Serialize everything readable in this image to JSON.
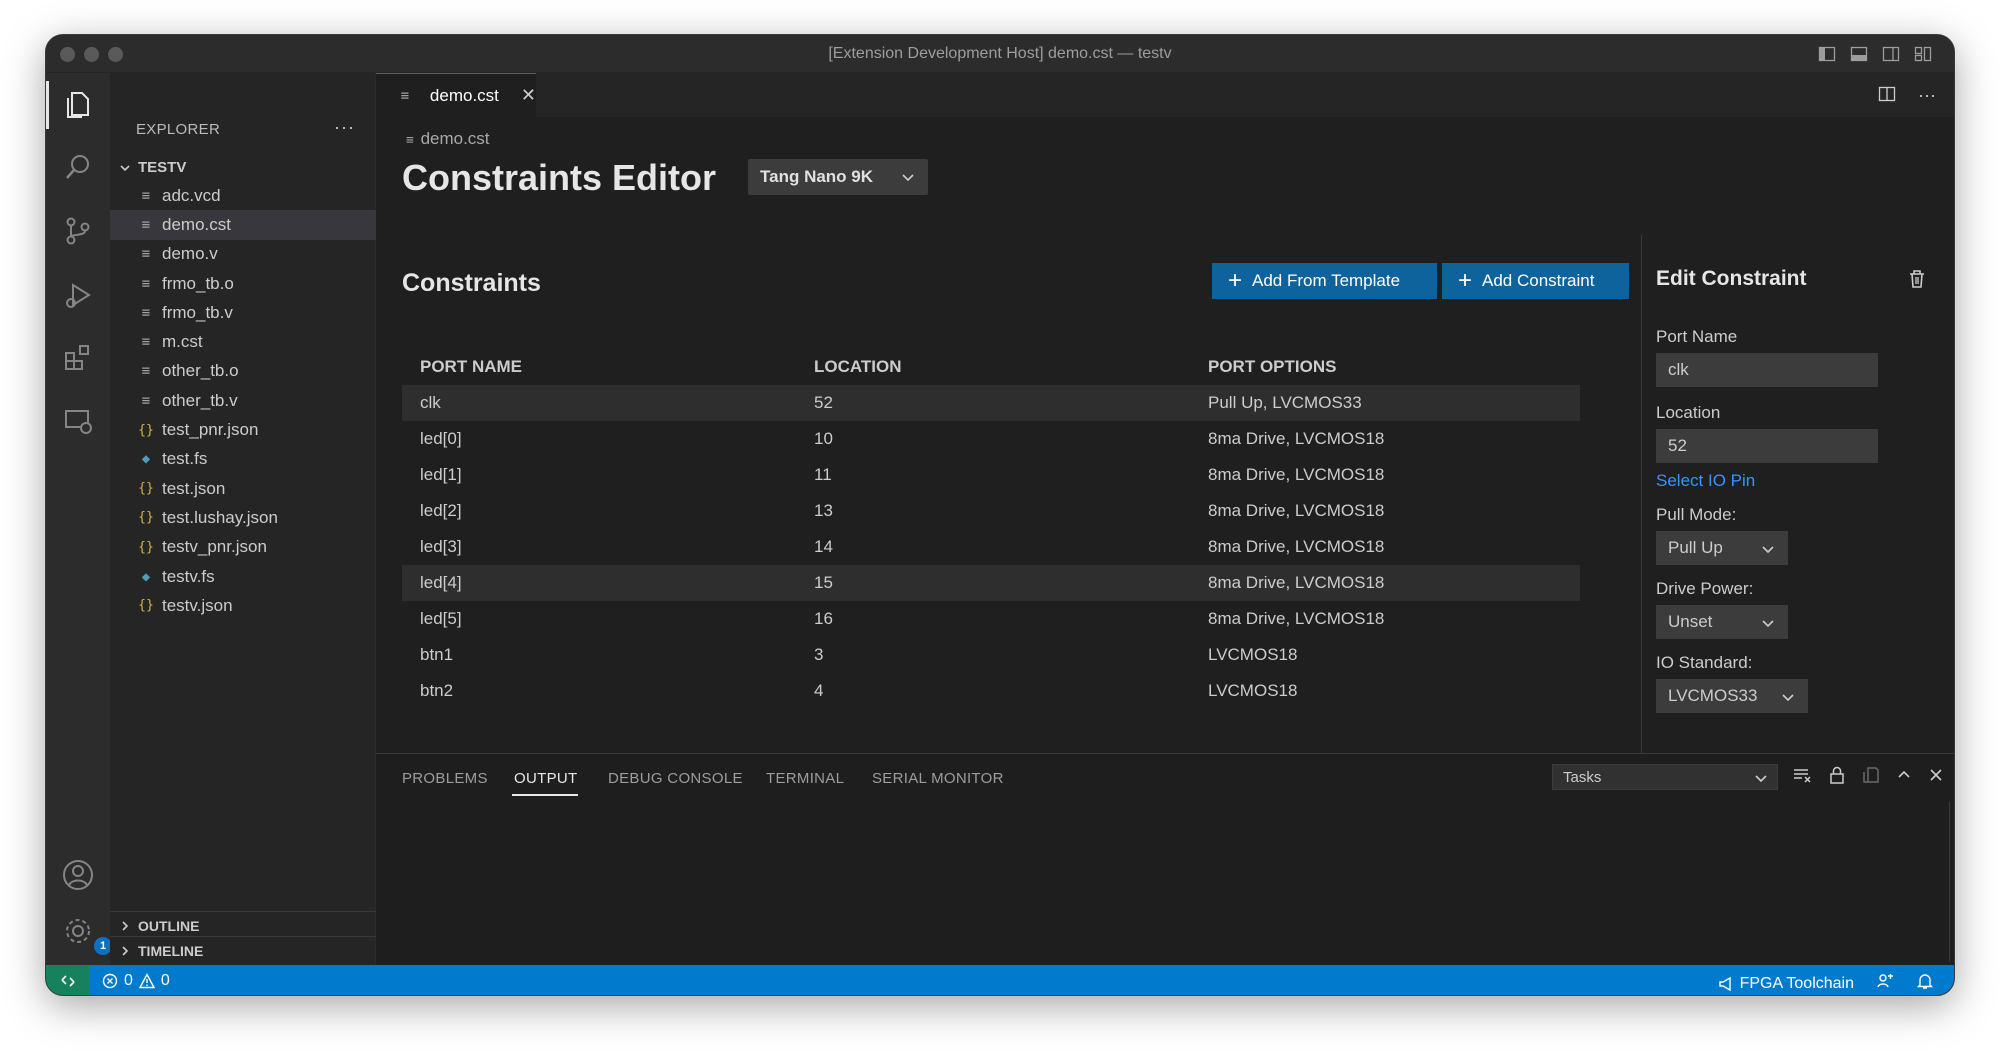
{
  "window": {
    "title": "[Extension Development Host] demo.cst — testv"
  },
  "sidebar": {
    "header": "EXPLORER",
    "more": "···",
    "folder": "TESTV",
    "files": [
      {
        "name": "adc.vcd",
        "icon": "lines"
      },
      {
        "name": "demo.cst",
        "icon": "lines",
        "selected": true
      },
      {
        "name": "demo.v",
        "icon": "lines"
      },
      {
        "name": "frmo_tb.o",
        "icon": "lines"
      },
      {
        "name": "frmo_tb.v",
        "icon": "lines"
      },
      {
        "name": "m.cst",
        "icon": "lines"
      },
      {
        "name": "other_tb.o",
        "icon": "lines"
      },
      {
        "name": "other_tb.v",
        "icon": "lines"
      },
      {
        "name": "test_pnr.json",
        "icon": "json"
      },
      {
        "name": "test.fs",
        "icon": "fs"
      },
      {
        "name": "test.json",
        "icon": "json"
      },
      {
        "name": "test.lushay.json",
        "icon": "json"
      },
      {
        "name": "testv_pnr.json",
        "icon": "json"
      },
      {
        "name": "testv.fs",
        "icon": "fs"
      },
      {
        "name": "testv.json",
        "icon": "json"
      }
    ],
    "outline": "OUTLINE",
    "timeline": "TIMELINE"
  },
  "activity": {
    "settings_badge": "1"
  },
  "editor": {
    "tab_label": "demo.cst",
    "breadcrumb": "demo.cst",
    "title": "Constraints Editor",
    "board": "Tang Nano 9K",
    "section_title": "Constraints",
    "add_template_label": "Add From Template",
    "add_constraint_label": "Add Constraint",
    "columns": [
      "PORT NAME",
      "LOCATION",
      "PORT OPTIONS"
    ],
    "rows": [
      {
        "port": "clk",
        "location": "52",
        "options": "Pull Up, LVCMOS33",
        "selected": true
      },
      {
        "port": "led[0]",
        "location": "10",
        "options": "8ma Drive, LVCMOS18"
      },
      {
        "port": "led[1]",
        "location": "11",
        "options": "8ma Drive, LVCMOS18"
      },
      {
        "port": "led[2]",
        "location": "13",
        "options": "8ma Drive, LVCMOS18"
      },
      {
        "port": "led[3]",
        "location": "14",
        "options": "8ma Drive, LVCMOS18"
      },
      {
        "port": "led[4]",
        "location": "15",
        "options": "8ma Drive, LVCMOS18",
        "selected": true
      },
      {
        "port": "led[5]",
        "location": "16",
        "options": "8ma Drive, LVCMOS18"
      },
      {
        "port": "btn1",
        "location": "3",
        "options": "LVCMOS18"
      },
      {
        "port": "btn2",
        "location": "4",
        "options": "LVCMOS18"
      }
    ]
  },
  "edit": {
    "title": "Edit Constraint",
    "port_name_label": "Port Name",
    "port_name_value": "clk",
    "location_label": "Location",
    "location_value": "52",
    "select_pin_link": "Select IO Pin",
    "pull_mode_label": "Pull Mode:",
    "pull_mode_value": "Pull Up",
    "drive_power_label": "Drive Power:",
    "drive_power_value": "Unset",
    "io_standard_label": "IO Standard:",
    "io_standard_value": "LVCMOS33"
  },
  "panel": {
    "tabs": [
      "PROBLEMS",
      "OUTPUT",
      "DEBUG CONSOLE",
      "TERMINAL",
      "SERIAL MONITOR"
    ],
    "active_tab": "OUTPUT",
    "output_channel": "Tasks"
  },
  "status": {
    "errors": "0",
    "warnings": "0",
    "toolchain": "FPGA Toolchain"
  },
  "colors": {
    "accent": "#007acc",
    "button": "#0e639c",
    "link": "#3794ff",
    "remote": "#16825d"
  }
}
